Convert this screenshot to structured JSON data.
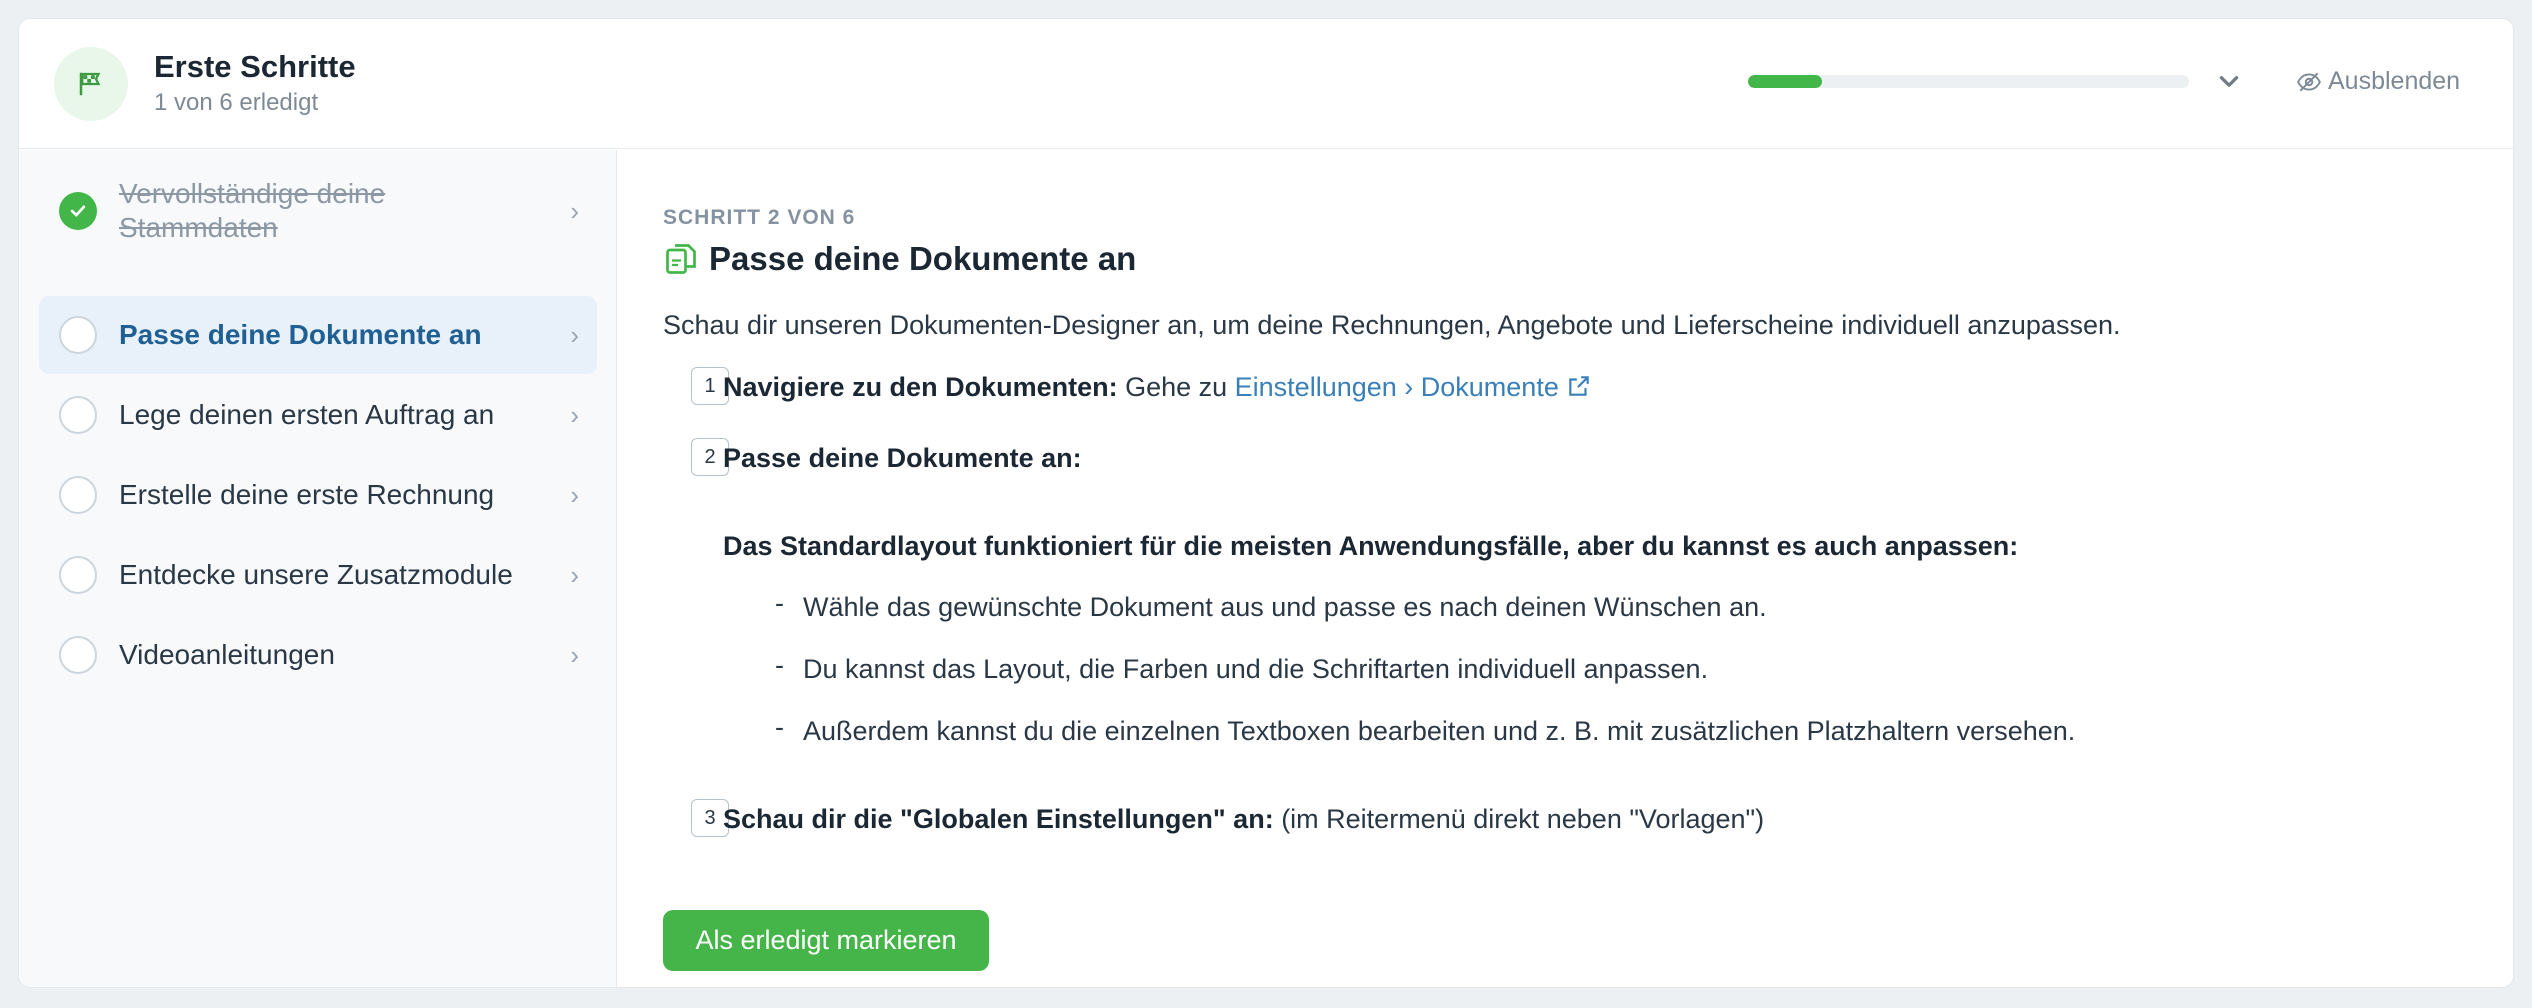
{
  "header": {
    "title": "Erste Schritte",
    "subtitle": "1 von 6 erledigt",
    "progress": 0.167,
    "hide_label": "Ausblenden",
    "flag_icon": "flag-icon",
    "accent_color": "#43b649"
  },
  "sidebar": {
    "items": [
      {
        "label": "Vervollständige deine Stammdaten",
        "state": "done"
      },
      {
        "label": "Passe deine Dokumente an",
        "state": "active"
      },
      {
        "label": "Lege deinen ersten Auftrag an",
        "state": "todo"
      },
      {
        "label": "Erstelle deine erste Rechnung",
        "state": "todo"
      },
      {
        "label": "Entdecke unsere Zusatzmodule",
        "state": "todo"
      },
      {
        "label": "Videoanleitungen",
        "state": "todo"
      }
    ]
  },
  "main": {
    "kicker": "SCHRITT 2 VON 6",
    "title": "Passe deine Dokumente an",
    "intro": "Schau dir unseren Dokumenten-Designer an, um deine Rechnungen, Angebote und Lieferscheine individuell anzupassen.",
    "steps": [
      {
        "num": "1",
        "bold": "Navigiere zu den Dokumenten:",
        "text": " Gehe zu ",
        "link": "Einstellungen › Dokumente"
      },
      {
        "num": "2",
        "bold": "Passe deine Dokumente an:",
        "subheading": "Das Standardlayout funktioniert für die meisten Anwendungsfälle, aber du kannst es auch anpassen:",
        "bullets": [
          "Wähle das gewünschte Dokument aus und passe es nach deinen Wünschen an.",
          "Du kannst das Layout, die Farben und die Schriftarten individuell anpassen.",
          "Außerdem kannst du die einzelnen Textboxen bearbeiten und z. B. mit zusätzlichen Platzhaltern versehen."
        ]
      },
      {
        "num": "3",
        "bold": "Schau dir die \"Globalen Einstellungen\" an:",
        "text": " (im Reitermenü direkt neben \"Vorlagen\")"
      }
    ],
    "button_label": "Als erledigt markieren"
  }
}
